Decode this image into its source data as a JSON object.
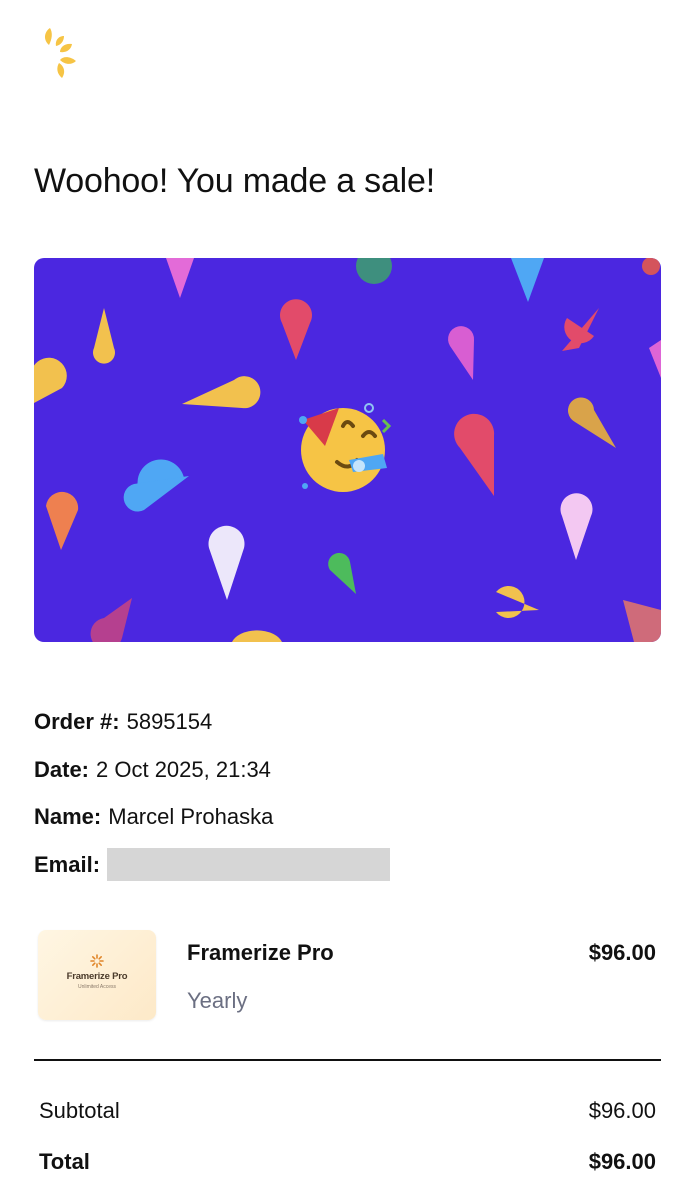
{
  "brand": {
    "logo_icon": "lemon-slice-icon",
    "logo_color": "#f6c445"
  },
  "headline": "Woohoo! You made a sale!",
  "banner": {
    "background": "#4b27e0",
    "center_icon": "party-face-emoji-icon",
    "decoration_icon": "confetti-icon"
  },
  "order": {
    "order_label": "Order #:",
    "order_value": "5895154",
    "date_label": "Date:",
    "date_value": "2 Oct 2025, 21:34",
    "name_label": "Name:",
    "name_value": "Marcel Prohaska",
    "email_label": "Email:"
  },
  "product": {
    "thumb_title": "Framerize Pro",
    "thumb_subtitle": "Unlimited Access",
    "name": "Framerize Pro",
    "plan": "Yearly",
    "price": "$96.00"
  },
  "summary": {
    "subtotal_label": "Subtotal",
    "subtotal_value": "$96.00",
    "total_label": "Total",
    "total_value": "$96.00"
  }
}
